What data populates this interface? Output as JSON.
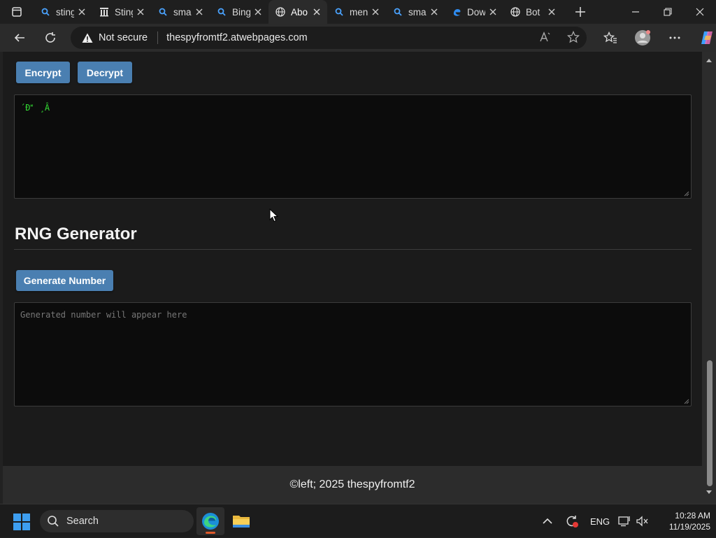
{
  "browser": {
    "tabs": [
      {
        "label": "sting",
        "icon": "bing-search-icon",
        "active": false
      },
      {
        "label": "Sting",
        "icon": "building-icon",
        "active": false
      },
      {
        "label": "smal",
        "icon": "bing-search-icon",
        "active": false
      },
      {
        "label": "Bing",
        "icon": "bing-search-icon",
        "active": false
      },
      {
        "label": "Abo",
        "icon": "globe-icon",
        "active": true
      },
      {
        "label": "men",
        "icon": "bing-search-icon",
        "active": false
      },
      {
        "label": "smal",
        "icon": "bing-search-icon",
        "active": false
      },
      {
        "label": "Dow",
        "icon": "edge-icon",
        "active": false
      },
      {
        "label": "Bot",
        "icon": "globe-icon",
        "active": false
      }
    ],
    "security_label": "Not secure",
    "url": "thespyfromtf2.atwebpages.com"
  },
  "page": {
    "encrypt_label": "Encrypt",
    "decrypt_label": "Decrypt",
    "cipher_output": "´Ð¸Â",
    "rng_heading": "RNG Generator",
    "generate_label": "Generate Number",
    "rng_placeholder": "Generated number will appear here",
    "footer_text": "©left; 2025 thespyfromtf2"
  },
  "taskbar": {
    "search_label": "Search",
    "language": "ENG",
    "time": "10:28 AM",
    "date": "11/19/2025"
  },
  "colors": {
    "button_blue": "#4a7fb1",
    "output_green": "#33dd33",
    "page_bg": "#1b1b1b"
  }
}
